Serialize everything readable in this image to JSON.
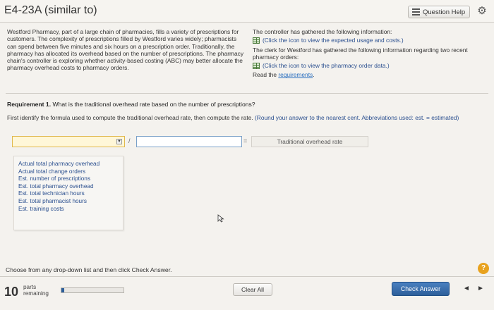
{
  "header": {
    "title": "E4-23A (similar to)",
    "help_label": "Question Help",
    "help_icon": "list-icon",
    "settings_icon": "gear-icon"
  },
  "intro": {
    "left_text": "Westford Pharmacy, part of a large chain of pharmacies, fills a variety of prescriptions for customers. The complexity of prescriptions filled by Westford varies widely; pharmacists can spend between five minutes and six hours on a prescription order. Traditionally, the pharmacy has allocated its overhead based on the number of prescriptions. The pharmacy chain's controller is exploring whether activity-based costing (ABC) may better allocate the pharmacy overhead costs to pharmacy orders.",
    "right_p1": "The controller has gathered the following information:",
    "right_link1": "(Click the icon to view the expected usage and costs.)",
    "right_p2": "The clerk for Westford has gathered the following information regarding two recent pharmacy orders:",
    "right_link2": "(Click the icon to view the pharmacy order data.)",
    "read_the": "Read the ",
    "requirements_link": "requirements",
    "period": "."
  },
  "requirement": {
    "label": "Requirement 1.",
    "question": " What is the traditional overhead rate based on the number of prescriptions?",
    "instruction": "First identify the formula used to compute the traditional overhead rate, then compute the rate. ",
    "hint": "(Round your answer to the nearest cent. Abbreviations used: est. = estimated)"
  },
  "formula": {
    "slash": "/",
    "equals": "=",
    "result_label": "Traditional overhead rate"
  },
  "dropdown_options": [
    "Actual total pharmacy overhead",
    "Actual total change orders",
    "Est. number of prescriptions",
    "Est. total pharmacy overhead",
    "Est. total technician hours",
    "Est. total pharmacist hours",
    "Est. training costs"
  ],
  "footer": {
    "choose_text": "Choose from any drop-down list and then click Check Answer.",
    "help_mark": "?",
    "parts_count": "10",
    "parts_label_1": "parts",
    "parts_label_2": "remaining",
    "progress_fraction": 0.05,
    "clear_all": "Clear All",
    "check_answer": "Check Answer",
    "prev_icon": "◄",
    "next_icon": "►"
  },
  "colors": {
    "accent": "#2d5f9a",
    "link": "#2a6fbf",
    "dropdown_highlight": "#fff7d8",
    "help_mark": "#e8a21e"
  }
}
